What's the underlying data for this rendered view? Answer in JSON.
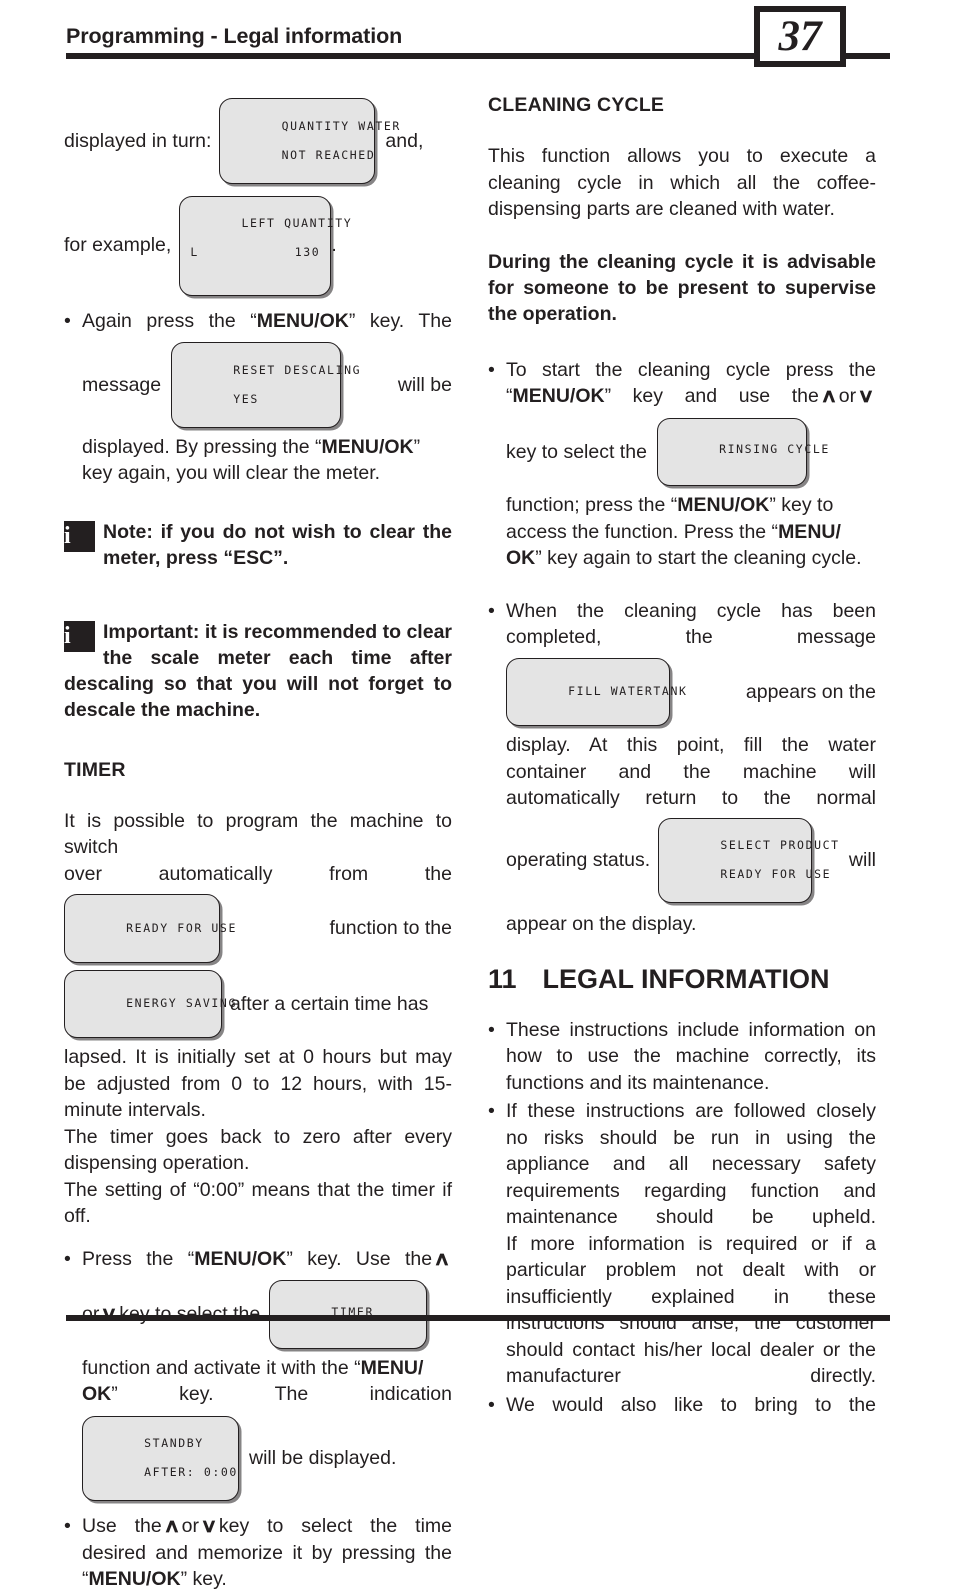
{
  "header": {
    "title": "Programming - Legal information",
    "page_number": "37"
  },
  "left_column": {
    "intro": {
      "text_before": "displayed in turn:",
      "lcd_quantity_water": {
        "line1": "QUANTITY WATER",
        "line2": "NOT REACHED"
      },
      "text_after": "and,",
      "text_before2": "for example,",
      "lcd_left_quantity": {
        "line1": "LEFT QUANTITY",
        "line2_left": "L",
        "line2_right": "130"
      },
      "text_after2": "."
    },
    "bullet_again_press": {
      "part1_a": "Again press the “",
      "part1_key": "MENU/OK",
      "part1_b": "” key. The",
      "part2": "message",
      "lcd_reset_descaling": {
        "line1": "RESET DESCALING",
        "line2": "YES"
      },
      "part3": "will   be",
      "part4_a": "displayed. By pressing the “",
      "part4_key": "MENU/OK",
      "part4_b": "”",
      "part5": "key again, you will clear the meter."
    },
    "note_1": {
      "icon": "info-icon",
      "text": "Note: if you do not wish to clear the meter, press “ESC”."
    },
    "note_2": {
      "icon": "info-icon",
      "text": "Important: it is recommended to clear the scale meter each time after descaling so that you will not forget to descale the machine."
    },
    "timer_heading": "TIMER",
    "timer_para_1a": "It is possible to program the machine to switch",
    "timer_para_1b": "over  automatically  from  the",
    "lcd_ready_for_use": "READY FOR USE",
    "timer_para_2": "function   to   the",
    "lcd_energy_saving": "ENERGY SAVING",
    "timer_para_3": "after a certain time has",
    "timer_para_4": "lapsed. It is initially set at 0 hours but may be adjusted from 0 to 12 hours, with 15-minute intervals.",
    "timer_para_5": "The timer goes back to zero after every dispensing operation.",
    "timer_para_6": "The setting of “0:00” means that the timer if off.",
    "bullet_press": {
      "p1_a": "Press the “",
      "p1_key": "MENU/OK",
      "p1_b": "” key. Use the",
      "up_arrow": "∧",
      "p2_a": "or",
      "down_arrow": "∨",
      "p2_b": "key to select the",
      "lcd_timer": "TIMER",
      "p3_a": "function and activate it with the “",
      "p3_key1": "MENU/",
      "p3_key2": "OK",
      "p3_b": "”   key.   The   indication",
      "lcd_standby": {
        "line1": "STANDBY",
        "line2": "AFTER: 0:00"
      },
      "p4": "will be displayed."
    },
    "bullet_use_arrow": {
      "a": "Use the",
      "up_arrow": "∧",
      "b": "or",
      "down_arrow": "∨",
      "c": "key to select the time desired and memorize it by pressing the “",
      "key": "MENU/OK",
      "d": "” key."
    }
  },
  "right_column": {
    "cleaning_heading": "CLEANING CYCLE",
    "cleaning_para": "This function allows you to execute a cleaning cycle in which all the coffee-dispensing parts are cleaned with water.",
    "cleaning_bold": "During the cleaning cycle it is advisable for someone to be present to supervise the operation.",
    "bullet_start": {
      "p1": "To  start  the  cleaning  cycle  press  the",
      "p2_a": "“",
      "p2_key": "MENU/OK",
      "p2_b": "” key and use the",
      "up_arrow": "∧",
      "p2_c": "or",
      "down_arrow": "∨",
      "p3": "key  to  select  the",
      "lcd_rinsing_cycle": "RINSING CYCLE",
      "p4_a": "function; press the “",
      "p4_key": "MENU/OK",
      "p4_b": "” key to",
      "p5_a": "access the function. Press the “",
      "p5_key1": "MENU/",
      "p5_key2": "OK",
      "p5_b": "” key again to start the cleaning cycle."
    },
    "bullet_completed": {
      "p1": "When  the  cleaning  cycle  has  been",
      "p2": "completed,        the        message",
      "lcd_fill_watertank": "FILL WATERTANK",
      "p3": "appears   on   the",
      "p4": "display. At this point, fill the water container and the machine will automatically return to the normal",
      "p5": "operating status.",
      "lcd_select_product": {
        "line1": "SELECT PRODUCT",
        "line2": "READY FOR USE"
      },
      "p6": "will",
      "p7": "appear on the display."
    },
    "legal_heading": {
      "number": "11",
      "title": "LEGAL INFORMATION"
    },
    "legal_bullets": [
      "These instructions include information on how to use the machine correctly, its functions and its maintenance.",
      "If these instructions are followed closely no risks should be run in using the appliance and all necessary safety requirements regarding function and maintenance should be upheld.",
      "We would also like to bring to the"
    ],
    "legal_para_extra": "If more information is required or if a particular problem not dealt with or insufficiently explained in these instructions should arise, the customer should contact his/her local dealer or the manufacturer directly."
  },
  "colors": {
    "ink": "#231f20",
    "lcd_fill": "#e4e4e4",
    "page_bg": "#ffffff"
  }
}
